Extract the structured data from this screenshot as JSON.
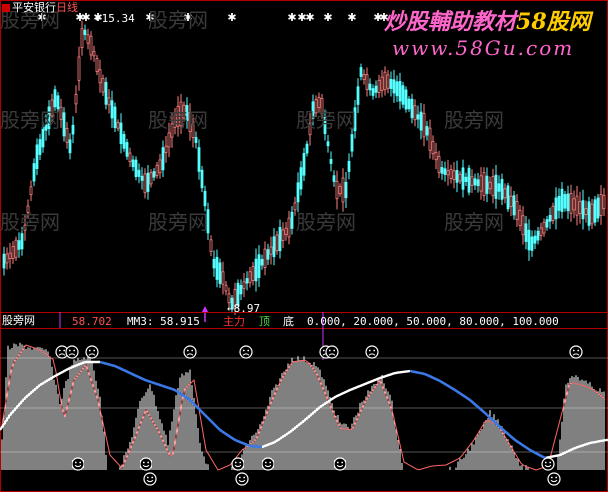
{
  "header": {
    "stock_name": "平安银行",
    "period": "日线",
    "site_title": "炒股輔助教材",
    "site_brand": "58股网",
    "site_url": "www.58Gu.com"
  },
  "watermark": "股旁网",
  "price_panel": {
    "high_label": "15.34",
    "low_label": "8.97",
    "star_glyph": "✱"
  },
  "indicator_bar": {
    "name": "股旁网",
    "mm1_value": "58.702",
    "mm3_label": "MM3:",
    "mm3_value": "58.915",
    "line_label": "主力",
    "top_label": "顶",
    "bottom_label": "底",
    "level_values": [
      "0.000",
      "20.000",
      "50.000",
      "80.000",
      "100.000"
    ]
  },
  "colors": {
    "background": "#000000",
    "candle_up": "#ff8080",
    "candle_down": "#55ffff",
    "frame": "#b00000",
    "blue_line": "#3b78e6",
    "white_line": "#ffffff",
    "level_value": "#ffffff",
    "site_title": "#ff66cc",
    "site_brand": "#ffcc00"
  },
  "chart_data": {
    "type": "line",
    "title": "",
    "price_extremes": {
      "high": 15.34,
      "low": 8.97
    },
    "indicator_levels": [
      0,
      20,
      50,
      80,
      100
    ]
  }
}
